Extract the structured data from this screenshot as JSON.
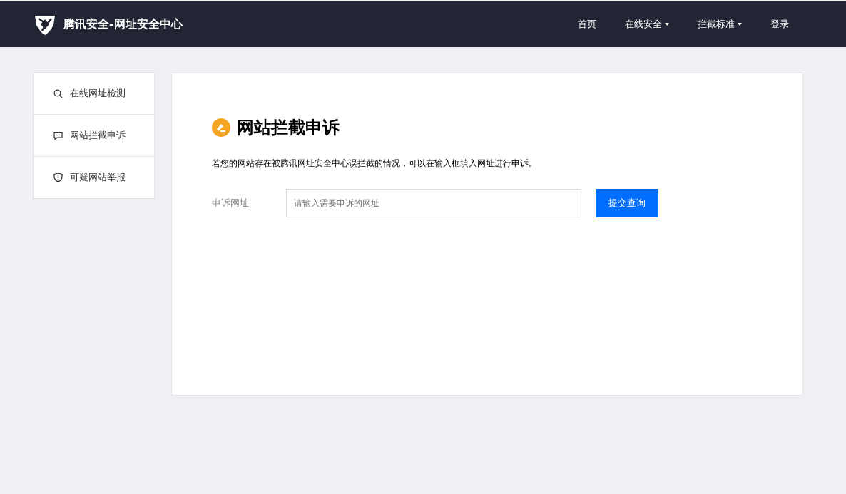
{
  "header": {
    "brand": "腾讯安全-网址安全中心",
    "nav": [
      {
        "label": "首页",
        "dropdown": false
      },
      {
        "label": "在线安全",
        "dropdown": true
      },
      {
        "label": "拦截标准",
        "dropdown": true
      },
      {
        "label": "登录",
        "dropdown": false
      }
    ]
  },
  "sidebar": {
    "items": [
      {
        "label": "在线网址检测",
        "kind": "search"
      },
      {
        "label": "网站拦截申诉",
        "kind": "appeal"
      },
      {
        "label": "可疑网站举报",
        "kind": "report"
      }
    ]
  },
  "main": {
    "title": "网站拦截申诉",
    "description": "若您的网站存在被腾讯网址安全中心误拦截的情况，可以在输入框填入网址进行申诉。",
    "field_label": "申诉网址",
    "placeholder": "请输入需要申诉的网址",
    "submit": "提交查询"
  }
}
